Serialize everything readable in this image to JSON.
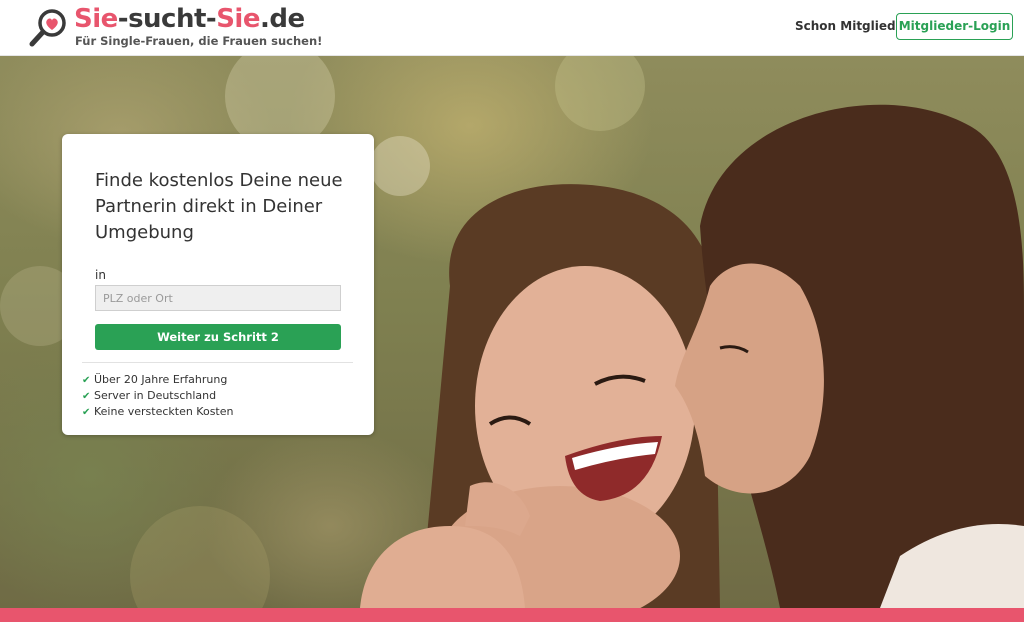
{
  "brand": {
    "title_part1": "Sie",
    "title_part2": "-sucht-",
    "title_part3": "Sie",
    "title_part4": ".de",
    "tagline": "Für Single-Frauen, die Frauen suchen!",
    "pink": "#e8556d",
    "dark": "#3a3a3a"
  },
  "header": {
    "member_question": "Schon Mitglied?",
    "login_label": "Mitglieder-Login",
    "accent": "#2aa155"
  },
  "signup": {
    "title": "Finde kostenlos Deine neue Partnerin direkt in Deiner Umgebung",
    "location_label": "in",
    "location_placeholder": "PLZ oder Ort",
    "location_value": "",
    "next_label": "Weiter zu Schritt 2",
    "features": [
      "Über 20 Jahre Erfahrung",
      "Server in Deutschland",
      "Keine versteckten Kosten"
    ],
    "check_icon": "check-icon"
  },
  "icons": {
    "logo": "magnifier-heart-icon"
  }
}
